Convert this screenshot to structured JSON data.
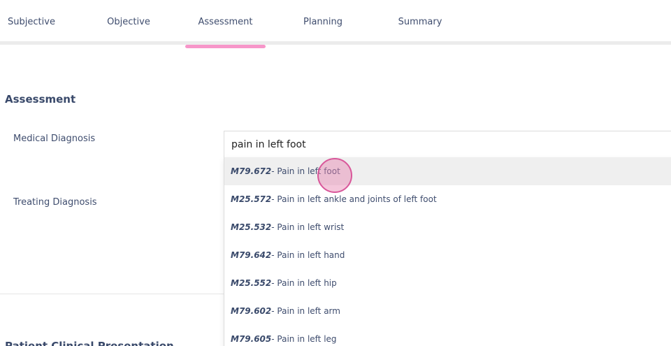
{
  "tabs": [
    {
      "label": "Subjective"
    },
    {
      "label": "Objective"
    },
    {
      "label": "Assessment"
    },
    {
      "label": "Planning"
    },
    {
      "label": "Summary"
    }
  ],
  "active_tab": "Assessment",
  "colors": {
    "accent": "#f796c9",
    "text": "#3a4a6b",
    "highlight_row": "#efefef"
  },
  "assessment": {
    "title": "Assessment",
    "medical_diagnosis_label": "Medical Diagnosis",
    "treating_diagnosis_label": "Treating Diagnosis",
    "search_value": "pain in left foot"
  },
  "dropdown": {
    "options": [
      {
        "code": "M79.672",
        "desc": " - Pain in left foot"
      },
      {
        "code": "M25.572",
        "desc": " - Pain in left ankle and joints of left foot"
      },
      {
        "code": "M25.532",
        "desc": " - Pain in left wrist"
      },
      {
        "code": "M79.642",
        "desc": " - Pain in left hand"
      },
      {
        "code": "M25.552",
        "desc": " - Pain in left hip"
      },
      {
        "code": "M79.602",
        "desc": " - Pain in left arm"
      },
      {
        "code": "M79.605",
        "desc": " - Pain in left leg"
      }
    ]
  },
  "next_section": {
    "title": "Patient Clinical Presentation"
  }
}
